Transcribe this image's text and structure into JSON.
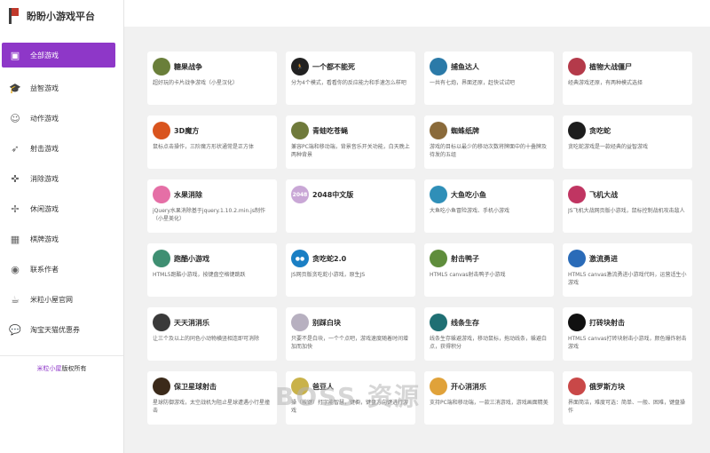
{
  "brand": {
    "title": "盼盼小游戏平台"
  },
  "sidebar": {
    "items": [
      {
        "label": "全部游戏",
        "icon": "twitch-icon",
        "glyph": "▣",
        "active": true
      },
      {
        "label": "益智游戏",
        "icon": "graduation-cap-icon",
        "glyph": "🎓"
      },
      {
        "label": "动作游戏",
        "icon": "reddit-icon",
        "glyph": "☺"
      },
      {
        "label": "射击游戏",
        "icon": "rocket-icon",
        "glyph": "➶"
      },
      {
        "label": "消除游戏",
        "icon": "puzzle-icon",
        "glyph": "✜"
      },
      {
        "label": "休闲游戏",
        "icon": "windmill-icon",
        "glyph": "✢"
      },
      {
        "label": "棋牌游戏",
        "icon": "checkerboard-icon",
        "glyph": "▦"
      },
      {
        "label": "联系作者",
        "icon": "user-icon",
        "glyph": "◉"
      },
      {
        "label": "米粒小屋官网",
        "icon": "coffee-icon",
        "glyph": "☕"
      },
      {
        "label": "淘宝天猫优惠券",
        "icon": "chat-icon",
        "glyph": "💬"
      }
    ]
  },
  "footer": {
    "link": "米粒小屋",
    "text": "版权所有"
  },
  "watermark": "BOSS 资源",
  "games": [
    {
      "title": "糖果战争",
      "desc": "超好玩的卡片战争游戏（小星汉化）",
      "color": "#6a7f3a"
    },
    {
      "title": "一个都不能死",
      "desc": "分为4个模式，看看你的反应能力和手速怎么样吧",
      "color": "#222222",
      "glyph": "🏃"
    },
    {
      "title": "捕鱼达人",
      "desc": "一共有七炮，界面还原，赶快试试吧",
      "color": "#2b7aa8"
    },
    {
      "title": "植物大战僵尸",
      "desc": "经典游戏还原，有两种模式选择",
      "color": "#b43a4a"
    },
    {
      "title": "3D魔方",
      "desc": "鼠标点击操作，三阶魔方形状通常是正方体",
      "color": "#d9541e"
    },
    {
      "title": "青蛙吃苍蝇",
      "desc": "兼容PC端和移动端，背景音乐开关功能，白天晚上两种背景",
      "color": "#6f7a3b"
    },
    {
      "title": "蜘蛛纸牌",
      "desc": "游戏的目标以最少的移动次数将牌面中的十叠牌及待发的五组",
      "color": "#8a6a3a"
    },
    {
      "title": "贪吃蛇",
      "desc": "贪吃蛇游戏是一款经典的益智游戏",
      "color": "#1d1d1d"
    },
    {
      "title": "水果消除",
      "desc": "jQuery水果消除基于jquery.1.10.2.min.js制作（小星美化）",
      "color": "#e56fa6"
    },
    {
      "title": "2048中文版",
      "desc": "",
      "color": "#c9a7d6",
      "glyph": "2048"
    },
    {
      "title": "大鱼吃小鱼",
      "desc": "大鱼吃小鱼冒险游戏、手机小游戏",
      "color": "#2f8fb8"
    },
    {
      "title": "飞机大战",
      "desc": "JS飞机大战网页版小游戏，鼠标控制战机攻击敌人",
      "color": "#c03562"
    },
    {
      "title": "跑酷小游戏",
      "desc": "HTML5跑酷小游戏，按键盘空格键跳跃",
      "color": "#3f8f72"
    },
    {
      "title": "贪吃蛇2.0",
      "desc": "JS网页版贪吃蛇小游戏，原生JS",
      "color": "#1a7fc4",
      "glyph": "●●"
    },
    {
      "title": "射击鸭子",
      "desc": "HTML5 canvas射击鸭子小游戏",
      "color": "#5f8d3c"
    },
    {
      "title": "激流勇进",
      "desc": "HTML5 canvas激流勇进小游戏代码，运营适生小游戏",
      "color": "#2a6bb8"
    },
    {
      "title": "天天消消乐",
      "desc": "让三个及以上的同色小动物横竖相连即可消除",
      "color": "#3a3a3a"
    },
    {
      "title": "别踩白块",
      "desc": "只要不是白块，一个个点吧，游戏速度随着时间增加而加快",
      "color": "#b7b0c0"
    },
    {
      "title": "线条生存",
      "desc": "线条生存躲避游戏，移动鼠标，拖动线条，躲避白点，获得积分",
      "color": "#1f6f73"
    },
    {
      "title": "打砖块射击",
      "desc": "HTML5 canvas打砖块射击小游戏，颜色爆炸射击游戏",
      "color": "#111111"
    },
    {
      "title": "保卫星球射击",
      "desc": "星球防御游戏，太空战机为阻止星球遭遇小行星撞击",
      "color": "#3b2a1a"
    },
    {
      "title": "爸豆人",
      "desc": "操（按键）打字能智慧，键橱，键盘方向键进行游戏",
      "color": "#c9b24a"
    },
    {
      "title": "开心消消乐",
      "desc": "支持PC端和移动端，一款三消游戏，游戏画面精美",
      "color": "#e0a23a"
    },
    {
      "title": "俄罗斯方块",
      "desc": "界面简洁，难度可选：简单、一般、困难，键盘操作",
      "color": "#c94848"
    }
  ]
}
